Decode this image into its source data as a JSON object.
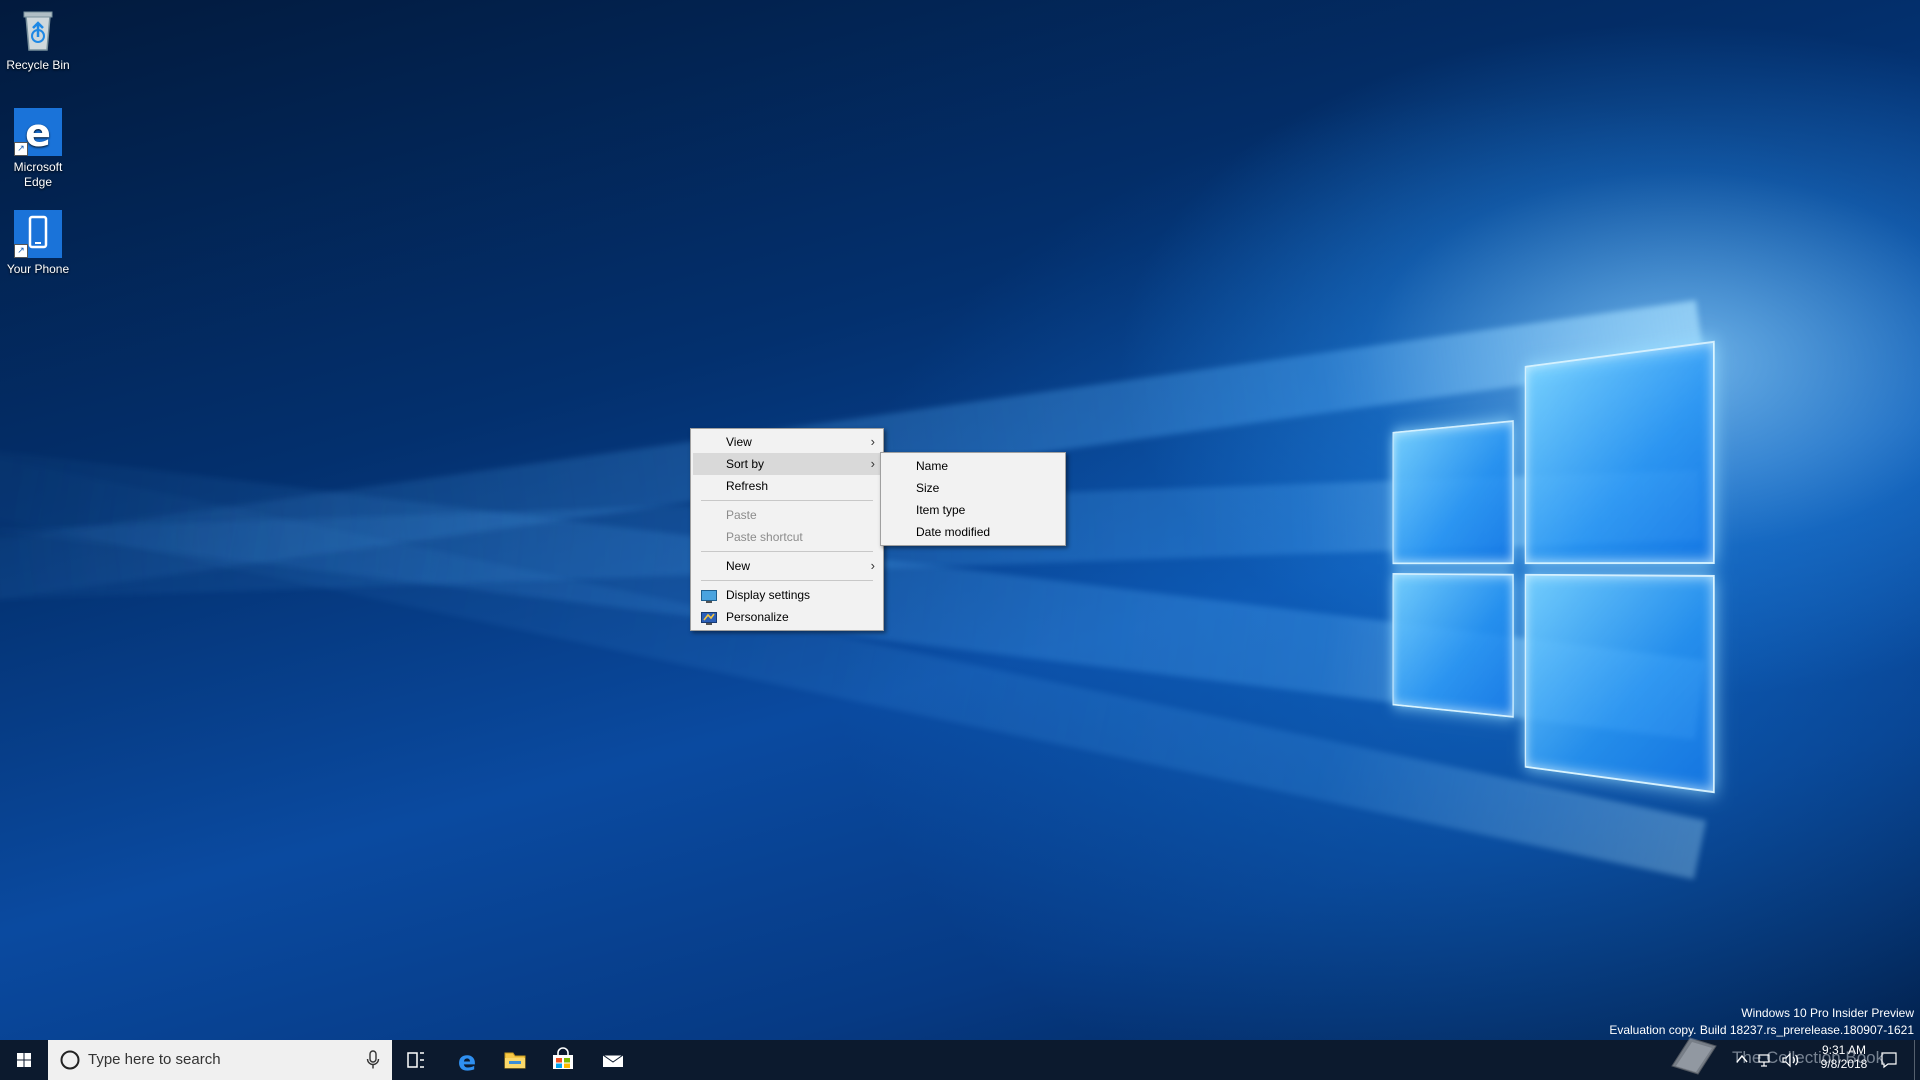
{
  "desktop": {
    "icons": [
      {
        "label": "Recycle Bin"
      },
      {
        "label": "Microsoft\nEdge"
      },
      {
        "label": "Your Phone"
      }
    ]
  },
  "context_menu": {
    "items": [
      {
        "label": "View",
        "has_submenu": true
      },
      {
        "label": "Sort by",
        "has_submenu": true
      },
      {
        "label": "Refresh"
      },
      {
        "label": "Paste"
      },
      {
        "label": "Paste shortcut"
      },
      {
        "label": "New",
        "has_submenu": true
      },
      {
        "label": "Display settings",
        "icon": "display-icon"
      },
      {
        "label": "Personalize",
        "icon": "personalize-icon"
      }
    ]
  },
  "sort_submenu": {
    "items": [
      {
        "label": "Name"
      },
      {
        "label": "Size"
      },
      {
        "label": "Item type"
      },
      {
        "label": "Date modified"
      }
    ]
  },
  "taskbar": {
    "search_placeholder": "Type here to search",
    "pinned": [
      "task-view-icon",
      "edge-icon",
      "file-explorer-icon",
      "store-icon",
      "mail-icon"
    ],
    "clock_time": "9:31 AM",
    "clock_date": "9/8/2018"
  },
  "watermark": {
    "line1": "Windows 10 Pro Insider Preview",
    "line2": "Evaluation copy. Build 18237.rs_prerelease.180907-1621",
    "overlay": "The Collection Book"
  },
  "colors": {
    "accent": "#0078d7",
    "taskbar": "#0c1a2e",
    "menu_bg": "#f2f2f2",
    "menu_hover": "#d9d9d9"
  }
}
